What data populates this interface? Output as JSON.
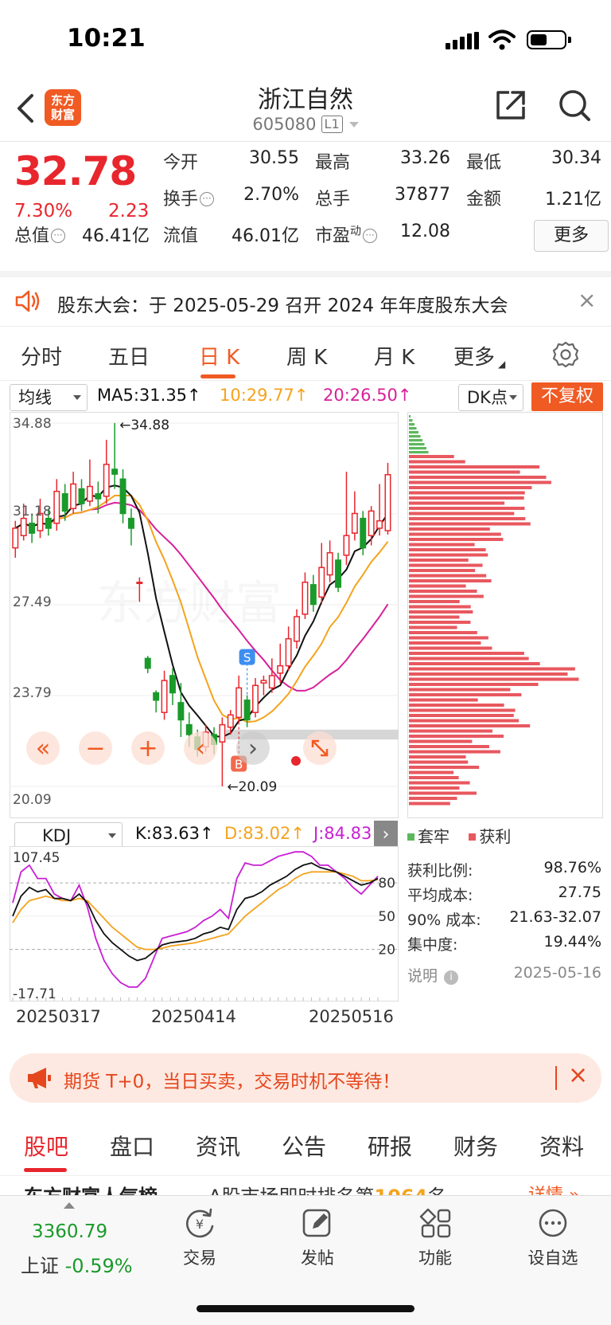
{
  "status": {
    "time": "10:21"
  },
  "header": {
    "name": "浙江自然",
    "code": "605080",
    "level": "L1"
  },
  "quote": {
    "price": "32.78",
    "change_pct": "7.30%",
    "change": "2.23",
    "rows": [
      [
        {
          "label": "今开",
          "value": "30.55",
          "color": "#222"
        },
        {
          "label": "最高",
          "value": "33.26",
          "color": "#e8262d"
        },
        {
          "label": "最低",
          "value": "30.34",
          "color": "#1a9a2a"
        }
      ],
      [
        {
          "label": "换手",
          "value": "2.70%",
          "color": "#222"
        },
        {
          "label": "总手",
          "value": "37877",
          "color": "#222"
        },
        {
          "label": "金额",
          "value": "1.21亿",
          "color": "#222"
        }
      ]
    ],
    "total_mv_label": "总值",
    "total_mv": "46.41亿",
    "float_mv_label": "流值",
    "float_mv": "46.01亿",
    "pe_label": "市盈",
    "pe_sup": "动",
    "pe": "12.08",
    "more": "更多"
  },
  "notice": {
    "text": "股东大会：于 2025-05-29 召开 2024 年年度股东大会",
    "close": "×"
  },
  "chart_tabs": [
    "分时",
    "五日",
    "日 K",
    "周 K",
    "月 K",
    "更多"
  ],
  "active_chart_tab": 2,
  "ma": {
    "selector": "均线",
    "ma5": "MA5:31.35",
    "ma10": "10:29.77",
    "ma20": "20:26.50",
    "dk": "DK点",
    "fuquan": "不复权",
    "colors": {
      "ma5": "#111111",
      "ma10": "#f4a31d",
      "ma20": "#d6219a"
    }
  },
  "chart_data": [
    {
      "type": "candlestick",
      "y_ticks": [
        "34.88",
        "31.18",
        "27.49",
        "23.79",
        "20.09"
      ],
      "ylim": [
        20.09,
        34.88
      ],
      "high_mark": "←34.88",
      "low_mark": "←20.09",
      "markers": [
        {
          "label": "S",
          "index": 28
        },
        {
          "label": "B",
          "index": 27
        }
      ],
      "candles": [
        [
          29.8,
          30.6,
          29.4,
          30.9
        ],
        [
          30.3,
          31.0,
          30.1,
          31.6
        ],
        [
          30.8,
          30.4,
          30.0,
          31.2
        ],
        [
          30.5,
          31.2,
          30.2,
          31.8
        ],
        [
          31.0,
          30.6,
          30.3,
          31.4
        ],
        [
          30.8,
          32.1,
          30.5,
          32.6
        ],
        [
          32.0,
          31.3,
          30.9,
          32.4
        ],
        [
          31.4,
          32.4,
          31.2,
          32.9
        ],
        [
          32.2,
          31.6,
          31.3,
          32.6
        ],
        [
          31.7,
          32.3,
          31.5,
          33.4
        ],
        [
          32.0,
          31.8,
          31.2,
          32.5
        ],
        [
          31.9,
          33.2,
          31.6,
          34.2
        ],
        [
          33.0,
          32.8,
          32.2,
          34.88
        ],
        [
          32.6,
          31.2,
          30.8,
          33.0
        ],
        [
          31.0,
          30.6,
          29.9,
          31.4
        ],
        [
          28.4,
          28.4,
          27.6,
          28.6
        ],
        [
          25.3,
          24.9,
          24.7,
          25.4
        ],
        [
          23.9,
          23.6,
          23.1,
          24.0
        ],
        [
          23.1,
          24.4,
          22.8,
          24.8
        ],
        [
          24.6,
          23.9,
          23.4,
          24.9
        ],
        [
          23.5,
          22.8,
          22.1,
          24.3
        ],
        [
          22.6,
          22.2,
          21.7,
          23.1
        ],
        [
          22.1,
          21.6,
          21.3,
          22.4
        ],
        [
          21.7,
          22.3,
          21.5,
          22.6
        ],
        [
          22.2,
          21.8,
          21.4,
          22.5
        ],
        [
          21.9,
          22.6,
          20.09,
          22.9
        ],
        [
          22.5,
          23.0,
          22.2,
          23.2
        ],
        [
          22.9,
          24.1,
          22.7,
          24.6
        ],
        [
          23.6,
          22.8,
          22.5,
          23.8
        ],
        [
          23.1,
          24.2,
          22.9,
          24.5
        ],
        [
          24.3,
          24.4,
          23.8,
          24.6
        ],
        [
          24.1,
          24.6,
          23.9,
          25.3
        ],
        [
          24.7,
          25.0,
          24.3,
          25.9
        ],
        [
          25.0,
          26.1,
          24.8,
          26.6
        ],
        [
          26.0,
          27.0,
          25.7,
          27.3
        ],
        [
          27.1,
          28.4,
          26.9,
          28.8
        ],
        [
          28.3,
          27.5,
          27.2,
          28.7
        ],
        [
          27.8,
          29.0,
          27.5,
          30.0
        ],
        [
          28.7,
          29.6,
          28.4,
          30.1
        ],
        [
          29.3,
          28.2,
          28.0,
          29.6
        ],
        [
          29.5,
          30.3,
          29.1,
          32.9
        ],
        [
          30.4,
          31.2,
          30.1,
          32.1
        ],
        [
          31.0,
          29.8,
          29.5,
          31.3
        ],
        [
          30.3,
          31.3,
          29.9,
          31.5
        ],
        [
          30.6,
          30.9,
          30.3,
          32.4
        ],
        [
          30.5,
          32.78,
          30.34,
          33.26
        ]
      ]
    },
    {
      "type": "heatmap",
      "legend": [
        "套牢",
        "获利"
      ],
      "colors": {
        "loss": "#5cb85c",
        "profit": "#e8585f"
      }
    },
    {
      "type": "line",
      "selector": "KDJ",
      "k_text": "K:83.63",
      "d_text": "D:83.02",
      "j_text": "J:84.83",
      "y_ticks": [
        "107.45",
        "80",
        "50",
        "20",
        "-17.71"
      ],
      "ylim": [
        -17.71,
        107.45
      ],
      "x_ticks": [
        "20250317",
        "20250414",
        "20250516"
      ],
      "series": [
        {
          "name": "K",
          "color": "#111111",
          "values": [
            50,
            68,
            76,
            72,
            74,
            66,
            66,
            64,
            70,
            62,
            46,
            34,
            26,
            20,
            14,
            10,
            12,
            18,
            24,
            26,
            27,
            28,
            30,
            34,
            36,
            40,
            38,
            56,
            66,
            68,
            72,
            78,
            82,
            86,
            92,
            96,
            98,
            94,
            92,
            90,
            86,
            82,
            78,
            80,
            84
          ]
        },
        {
          "name": "D",
          "color": "#f4a31d",
          "values": [
            44,
            56,
            64,
            66,
            68,
            66,
            64,
            64,
            66,
            64,
            56,
            48,
            40,
            34,
            28,
            22,
            20,
            20,
            21,
            23,
            24,
            25,
            26,
            28,
            30,
            32,
            34,
            42,
            50,
            56,
            62,
            68,
            74,
            78,
            84,
            88,
            90,
            90,
            90,
            90,
            88,
            86,
            82,
            82,
            83
          ]
        },
        {
          "name": "J",
          "color": "#c81fd4",
          "values": [
            62,
            90,
            96,
            84,
            84,
            70,
            66,
            64,
            78,
            58,
            30,
            10,
            -2,
            -10,
            -14,
            -14,
            -6,
            12,
            30,
            32,
            34,
            36,
            40,
            46,
            50,
            56,
            48,
            84,
            98,
            96,
            96,
            100,
            104,
            106,
            108,
            108,
            104,
            96,
            96,
            90,
            84,
            76,
            70,
            78,
            86
          ]
        }
      ]
    }
  ],
  "chip_stats": {
    "rows": [
      {
        "label": "获利比例:",
        "value": "98.76%"
      },
      {
        "label": "平均成本:",
        "value": "27.75"
      },
      {
        "label": "90% 成本:",
        "value": "21.63-32.07"
      },
      {
        "label": "集中度:",
        "value": "19.44%"
      }
    ],
    "explain": "说明",
    "date": "2025-05-16"
  },
  "ad": {
    "text": "期货 T+0，当日买卖，交易时机不等待！",
    "close": "×"
  },
  "bottom_tabs": [
    "股吧",
    "盘口",
    "资讯",
    "公告",
    "研报",
    "财务",
    "资料"
  ],
  "feed_peek": {
    "left": "东方财富人气榜",
    "mid": "A股市场即时排名第",
    "rank": "1064",
    "unit": "名",
    "right": "详情 »"
  },
  "bottom_nav": {
    "index_value": "3360.79",
    "index_name": "上证",
    "index_change": "-0.59%",
    "items": [
      "交易",
      "发帖",
      "功能",
      "设自选"
    ]
  }
}
